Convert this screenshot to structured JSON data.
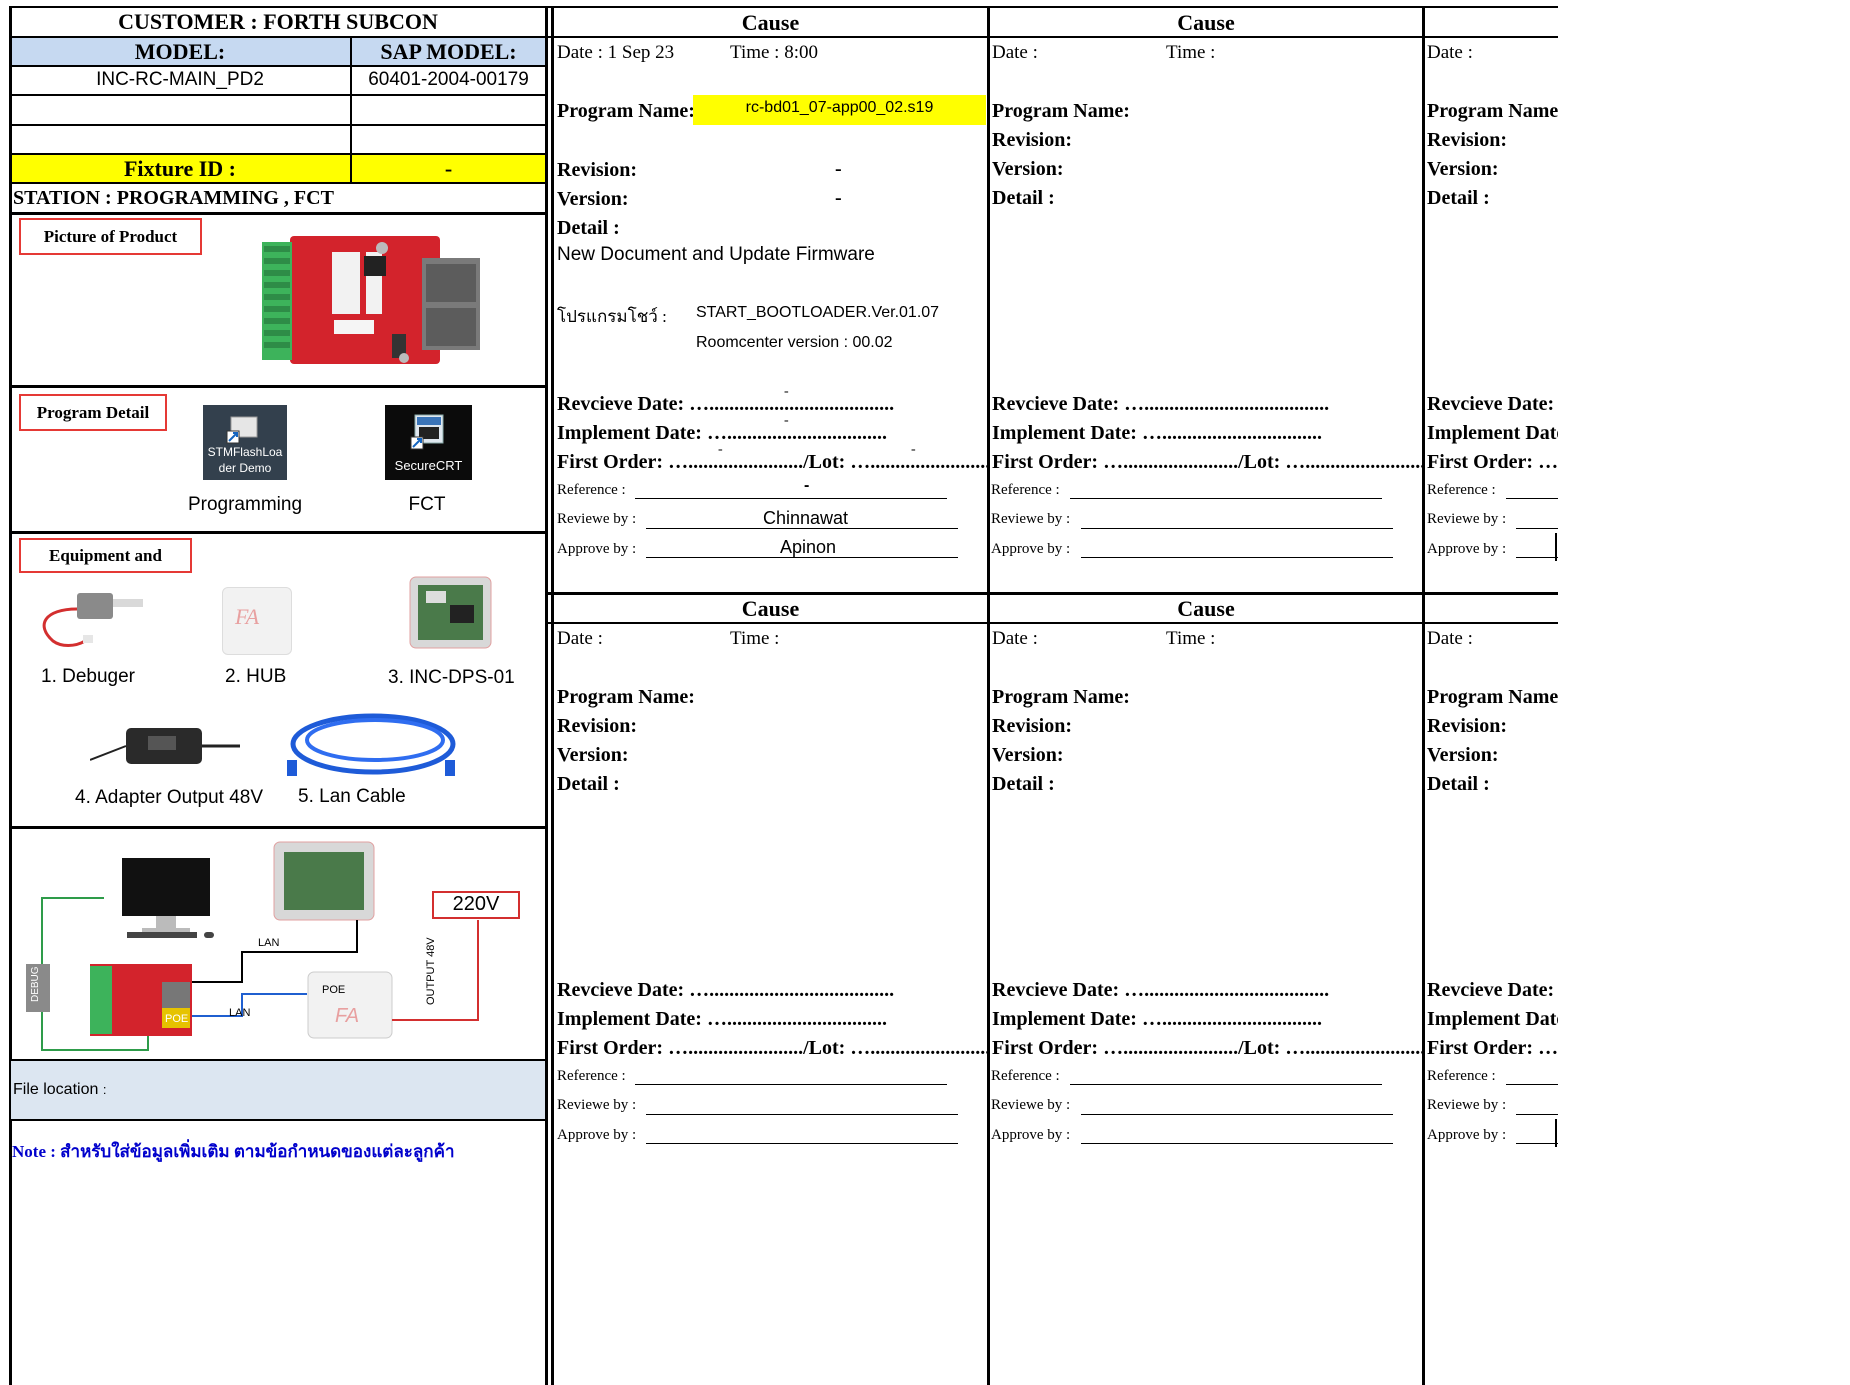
{
  "header": {
    "customer": "CUSTOMER : FORTH SUBCON",
    "model_label": "MODEL:",
    "sap_model_label": "SAP MODEL:",
    "model_value": "INC-RC-MAIN_PD2",
    "sap_model_value": "60401-2004-00179",
    "fixture_label": "Fixture ID :",
    "fixture_value": "-",
    "station": "STATION : PROGRAMMING , FCT"
  },
  "sections": {
    "picture": "Picture of Product",
    "program_detail": "Program Detail",
    "equipment": "Equipment and"
  },
  "programs": [
    {
      "icon_label_1": "STMFlashLoa",
      "icon_label_2": "der Demo",
      "caption": "Programming",
      "icon": "stm-flash-loader-icon"
    },
    {
      "icon_label_1": "SecureCRT",
      "caption": "FCT",
      "icon": "securecrt-icon"
    }
  ],
  "equipment": {
    "items": [
      "1. Debuger",
      "2. HUB",
      "3. INC-DPS-01",
      "4. Adapter Output 48V",
      "5. Lan Cable"
    ],
    "hub_mark": "FA"
  },
  "diagram": {
    "voltage": "220V",
    "output": "OUTPUT 48V",
    "lan1": "LAN",
    "lan2": "LAN",
    "poe_box": "POE",
    "poe_board": "POE",
    "debug": "DEBUG",
    "hub_mark": "FA"
  },
  "footer": {
    "file_location": "File location",
    "file_location_colon": ":",
    "note": "Note : สำหรับใส่ข้อมูลเพิ่มเติม ตามข้อกำหนดของแต่ละลูกค้า"
  },
  "labels": {
    "cause": "Cause",
    "date": "Date :",
    "time": "Time :",
    "program_name": "Program Name:",
    "revision": "Revision:",
    "version": "Version:",
    "detail": "Detail :",
    "receive_date": "Revcieve Date: ….....................................",
    "implement_date": "Implement Date: …................................",
    "first_order": "First Order: …......................./Lot: …........................",
    "reference": "Reference :",
    "review_by": "Reviewe by :",
    "approve_by": "Approve by :",
    "receive_short": "Revcieve Date: .",
    "implement_short": "Implement Date",
    "first_short": "First Order: ….",
    "program_name_short": "Program Name:"
  },
  "entry1": {
    "date": "Date : 1 Sep 23",
    "time": "Time : 8:00",
    "program_name": "rc-bd01_07-app00_02.s19",
    "revision": "-",
    "version": "-",
    "detail": "New Document and Update Firmware",
    "program_thai": "โปรแกรมโชว์ :",
    "bootloader": "START_BOOTLOADER.Ver.01.07",
    "roomcenter": "Roomcenter version : 00.02",
    "receive_mark": "-",
    "implement_mark": "-",
    "first_mark": "-",
    "lot_mark": "-",
    "reference": "-",
    "reviewer": "Chinnawat",
    "approver": "Apinon"
  },
  "colors": {
    "header_blue": "#c6d9f1",
    "yellow": "#ffff00",
    "red_box": "#e53935",
    "footer_blue": "#dce6f1",
    "note_blue": "#0000cc"
  }
}
